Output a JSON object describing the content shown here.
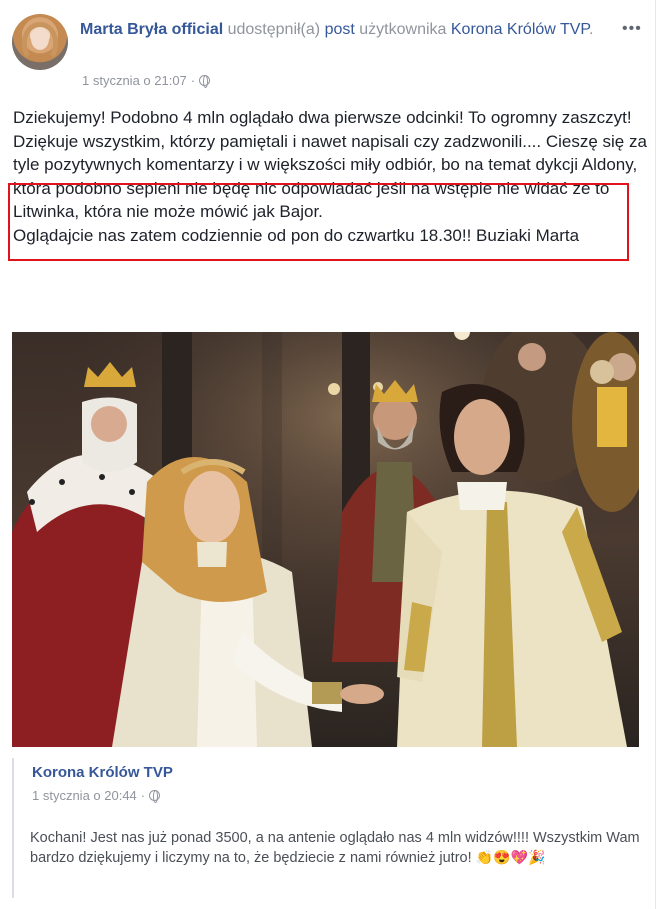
{
  "post": {
    "author_name": "Marta Bryła official",
    "action_1": "udostępnił(a)",
    "post_word": "post",
    "action_2": "użytkownika",
    "shared_page": "Korona Królów TVP",
    "period": ".",
    "timestamp": "1 stycznia o 21:07",
    "separator": "·",
    "more_label": "•••",
    "paragraphs": [
      "Dziekujemy! Podobno 4 mln oglądało dwa pierwsze odcinki! To ogromny zaszczyt! Dziękuje wszystkim, którzy pamiętali i nawet napisali czy zadzwonili.... Cieszę się za tyle pozytywnych komentarzy i w większości miły odbiór, bo na temat dykcji Aldony, która podobno sepleni nie będę nic odpowiadać jeśli na wstępie nie widać ze to Litwinka, która nie może mówić jak Bajor.",
      "Oglądajcie nas zatem codziennie od pon do czwartku 18.30!! Buziaki Marta"
    ],
    "highlight_color": "#e0131d"
  },
  "shared": {
    "page_name": "Korona Królów TVP",
    "timestamp": "1 stycznia o 20:44",
    "separator": "·",
    "text": "Kochani! Jest nas już ponad 3500, a na antenie oglądało nas 4 mln widzów!!!! Wszystkim Wam bardzo dziękujemy i liczymy na to, że będziecie z nami również jutro!",
    "emojis": [
      "👏",
      "😍",
      "💖",
      "🎉"
    ]
  },
  "colors": {
    "link": "#365899",
    "meta_gray": "#90949c",
    "text": "#1d2129"
  }
}
